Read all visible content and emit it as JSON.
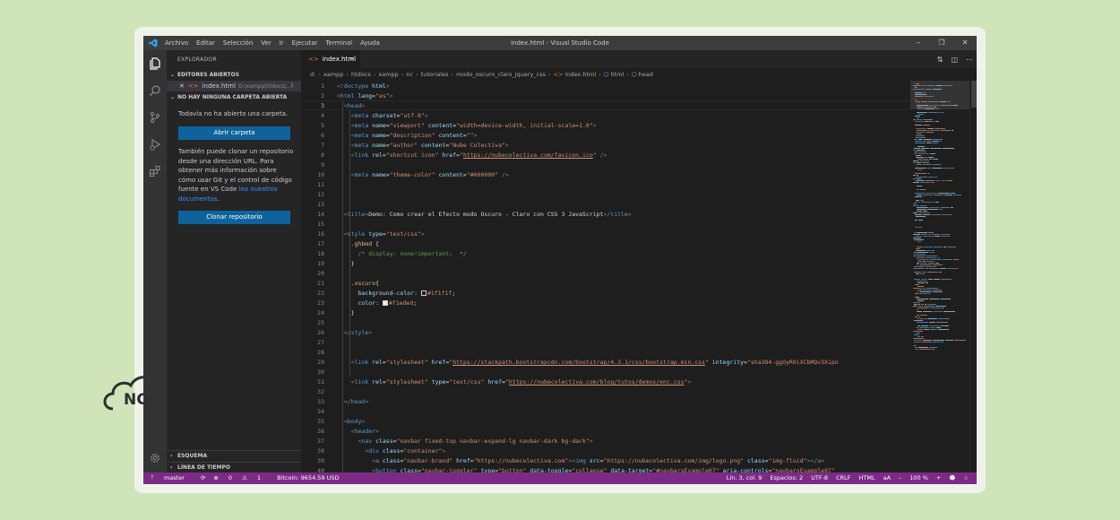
{
  "window": {
    "title": "index.html - Visual Studio Code",
    "menus": [
      "Archivo",
      "Editar",
      "Selección",
      "Ver",
      "Ir",
      "Ejecutar",
      "Terminal",
      "Ayuda"
    ]
  },
  "activity": {
    "icons": [
      "files-icon",
      "search-icon",
      "source-control-icon",
      "run-debug-icon",
      "extensions-icon",
      "gear-icon"
    ]
  },
  "sidebar": {
    "title": "EXPLORADOR",
    "open_editors_label": "EDITORES ABIERTOS",
    "open_file": {
      "name": "index.html",
      "path": "D:\\xampp\\htdocs\\...",
      "badge": "1"
    },
    "no_folder_label": "NO HAY NINGUNA CARPETA ABIERTA",
    "no_folder_text": "Todavía no ha abierto una carpeta.",
    "open_folder_button": "Abrir carpeta",
    "clone_text": "También puede clonar un repositorio desde una dirección URL. Para obtener más información sobre cómo usar Git y el control de código fuente en VS Code ",
    "clone_link": "lea nuestros documentos",
    "clone_text_end": ".",
    "clone_button": "Clonar repositorio",
    "outline_label": "ESQUEMA",
    "timeline_label": "LÍNEA DE TIEMPO"
  },
  "tab": {
    "label": "index.html",
    "close": "×"
  },
  "breadcrumb": [
    "d:",
    "xampp",
    "htdocs",
    "xampp",
    "nc",
    "tutoriales",
    "modo_oscuro_claro_jquery_css",
    "index.html",
    "html",
    "head"
  ],
  "editor": {
    "line_numbers": [
      "1",
      "2",
      "3",
      "4",
      "5",
      "6",
      "7",
      "8",
      "9",
      "10",
      "11",
      "12",
      "13",
      "14",
      "15",
      "16",
      "17",
      "18",
      "19",
      "20",
      "21",
      "22",
      "23",
      "24",
      "25",
      "26",
      "27",
      "28",
      "29",
      "30",
      "31",
      "32",
      "33",
      "34",
      "35",
      "36",
      "37",
      "38",
      "39",
      "40"
    ],
    "lines": [
      [
        [
          "t-punc",
          "<!"
        ],
        [
          "t-tag",
          "doctype"
        ],
        [
          "t-attr",
          " html"
        ],
        [
          "t-punc",
          ">"
        ]
      ],
      [
        [
          "t-punc",
          "<"
        ],
        [
          "t-tag",
          "html"
        ],
        [
          "t-attr",
          " lang"
        ],
        [
          "t-text",
          "="
        ],
        [
          "t-str",
          "\"es\""
        ],
        [
          "t-punc",
          ">"
        ]
      ],
      [
        [
          "t-text",
          "  "
        ],
        [
          "t-punc",
          "<"
        ],
        [
          "t-tag",
          "head"
        ],
        [
          "t-punc",
          ">"
        ]
      ],
      [
        [
          "t-text",
          "    "
        ],
        [
          "t-punc",
          "<"
        ],
        [
          "t-tag",
          "meta"
        ],
        [
          "t-attr",
          " charset"
        ],
        [
          "t-text",
          "="
        ],
        [
          "t-str",
          "\"utf-8\""
        ],
        [
          "t-punc",
          ">"
        ]
      ],
      [
        [
          "t-text",
          "    "
        ],
        [
          "t-punc",
          "<"
        ],
        [
          "t-tag",
          "meta"
        ],
        [
          "t-attr",
          " name"
        ],
        [
          "t-text",
          "="
        ],
        [
          "t-str",
          "\"viewport\""
        ],
        [
          "t-attr",
          " content"
        ],
        [
          "t-text",
          "="
        ],
        [
          "t-str",
          "\"width=device-width, initial-scale=1.0\""
        ],
        [
          "t-punc",
          ">"
        ]
      ],
      [
        [
          "t-text",
          "    "
        ],
        [
          "t-punc",
          "<"
        ],
        [
          "t-tag",
          "meta"
        ],
        [
          "t-attr",
          " name"
        ],
        [
          "t-text",
          "="
        ],
        [
          "t-str",
          "\"description\""
        ],
        [
          "t-attr",
          " content"
        ],
        [
          "t-text",
          "="
        ],
        [
          "t-str",
          "\"\""
        ],
        [
          "t-punc",
          ">"
        ]
      ],
      [
        [
          "t-text",
          "    "
        ],
        [
          "t-punc",
          "<"
        ],
        [
          "t-tag",
          "meta"
        ],
        [
          "t-attr",
          " name"
        ],
        [
          "t-text",
          "="
        ],
        [
          "t-str",
          "\"author\""
        ],
        [
          "t-attr",
          " content"
        ],
        [
          "t-text",
          "="
        ],
        [
          "t-str",
          "\"Nube Colectiva\""
        ],
        [
          "t-punc",
          ">"
        ]
      ],
      [
        [
          "t-text",
          "    "
        ],
        [
          "t-punc",
          "<"
        ],
        [
          "t-tag",
          "link"
        ],
        [
          "t-attr",
          " rel"
        ],
        [
          "t-text",
          "="
        ],
        [
          "t-str",
          "\"shortcut icon\""
        ],
        [
          "t-attr",
          " href"
        ],
        [
          "t-text",
          "="
        ],
        [
          "t-str",
          "\""
        ],
        [
          "t-link",
          "https://nubecolectiva.com/favicon.ico"
        ],
        [
          "t-str",
          "\""
        ],
        [
          "t-punc",
          " />"
        ]
      ],
      [],
      [
        [
          "t-text",
          "    "
        ],
        [
          "t-punc",
          "<"
        ],
        [
          "t-tag",
          "meta"
        ],
        [
          "t-attr",
          " name"
        ],
        [
          "t-text",
          "="
        ],
        [
          "t-str",
          "\"theme-color\""
        ],
        [
          "t-attr",
          " content"
        ],
        [
          "t-text",
          "="
        ],
        [
          "t-str",
          "\"#000000\""
        ],
        [
          "t-punc",
          " />"
        ]
      ],
      [],
      [],
      [],
      [
        [
          "t-text",
          "  "
        ],
        [
          "t-punc",
          "<"
        ],
        [
          "t-tag",
          "title"
        ],
        [
          "t-punc",
          ">"
        ],
        [
          "t-text",
          "Demo: Como crear el Efecto modo Oscuro - Claro con CSS 3 JavaScript"
        ],
        [
          "t-punc",
          "</"
        ],
        [
          "t-tag",
          "title"
        ],
        [
          "t-punc",
          ">"
        ]
      ],
      [],
      [
        [
          "t-text",
          "  "
        ],
        [
          "t-punc",
          "<"
        ],
        [
          "t-tag",
          "style"
        ],
        [
          "t-attr",
          " type"
        ],
        [
          "t-text",
          "="
        ],
        [
          "t-str",
          "\"text/css\""
        ],
        [
          "t-punc",
          ">"
        ]
      ],
      [
        [
          "t-text",
          "    "
        ],
        [
          "t-sel",
          ".ghbmd"
        ],
        [
          "t-text",
          " {"
        ]
      ],
      [
        [
          "t-text",
          "      "
        ],
        [
          "t-com",
          "/* display: none!important;  */"
        ]
      ],
      [
        [
          "t-text",
          "    }"
        ]
      ],
      [],
      [
        [
          "t-text",
          "    "
        ],
        [
          "t-sel",
          ".oscuro"
        ],
        [
          "t-text",
          "{"
        ]
      ],
      [
        [
          "t-text",
          "      "
        ],
        [
          "t-prop",
          "background-color"
        ],
        [
          "t-text",
          ": "
        ],
        [
          "swatch",
          "#1f1f1f"
        ],
        [
          "t-val",
          "#1f1f1f"
        ],
        [
          "t-text",
          ";"
        ]
      ],
      [
        [
          "t-text",
          "      "
        ],
        [
          "t-prop",
          "color"
        ],
        [
          "t-text",
          ": "
        ],
        [
          "swatch",
          "#f1eded"
        ],
        [
          "t-val",
          "#f1eded"
        ],
        [
          "t-text",
          ";"
        ]
      ],
      [
        [
          "t-text",
          "    }"
        ]
      ],
      [],
      [
        [
          "t-text",
          "  "
        ],
        [
          "t-punc",
          "</"
        ],
        [
          "t-tag",
          "style"
        ],
        [
          "t-punc",
          ">"
        ]
      ],
      [],
      [],
      [
        [
          "t-text",
          "    "
        ],
        [
          "t-punc",
          "<"
        ],
        [
          "t-tag",
          "link"
        ],
        [
          "t-attr",
          " rel"
        ],
        [
          "t-text",
          "="
        ],
        [
          "t-str",
          "\"stylesheet\""
        ],
        [
          "t-attr",
          " href"
        ],
        [
          "t-text",
          "="
        ],
        [
          "t-str",
          "\""
        ],
        [
          "t-link",
          "https://stackpath.bootstrapcdn.com/bootstrap/4.3.1/css/bootstrap.min.css"
        ],
        [
          "t-str",
          "\""
        ],
        [
          "t-attr",
          " integrity"
        ],
        [
          "t-text",
          "="
        ],
        [
          "t-str",
          "\"sha384-ggOyR0iXCbMQv3Xipn"
        ]
      ],
      [],
      [
        [
          "t-text",
          "    "
        ],
        [
          "t-punc",
          "<"
        ],
        [
          "t-tag",
          "link"
        ],
        [
          "t-attr",
          " rel"
        ],
        [
          "t-text",
          "="
        ],
        [
          "t-str",
          "\"stylesheet\""
        ],
        [
          "t-attr",
          " type"
        ],
        [
          "t-text",
          "="
        ],
        [
          "t-str",
          "\"text/css\""
        ],
        [
          "t-attr",
          " href"
        ],
        [
          "t-text",
          "="
        ],
        [
          "t-str",
          "\""
        ],
        [
          "t-link",
          "https://nubecolectiva.com/blog/tutos/demos/enc.css"
        ],
        [
          "t-str",
          "\""
        ],
        [
          "t-punc",
          ">"
        ]
      ],
      [],
      [
        [
          "t-text",
          "  "
        ],
        [
          "t-punc",
          "</"
        ],
        [
          "t-tag",
          "head"
        ],
        [
          "t-punc",
          ">"
        ]
      ],
      [],
      [
        [
          "t-text",
          "  "
        ],
        [
          "t-punc",
          "<"
        ],
        [
          "t-tag",
          "body"
        ],
        [
          "t-punc",
          ">"
        ]
      ],
      [
        [
          "t-text",
          "    "
        ],
        [
          "t-punc",
          "<"
        ],
        [
          "t-tag",
          "header"
        ],
        [
          "t-punc",
          ">"
        ]
      ],
      [
        [
          "t-text",
          "      "
        ],
        [
          "t-punc",
          "<"
        ],
        [
          "t-tag",
          "nav"
        ],
        [
          "t-attr",
          " class"
        ],
        [
          "t-text",
          "="
        ],
        [
          "t-str",
          "\"navbar fixed-top navbar-expand-lg navbar-dark bg-dark\""
        ],
        [
          "t-punc",
          ">"
        ]
      ],
      [
        [
          "t-text",
          "        "
        ],
        [
          "t-punc",
          "<"
        ],
        [
          "t-tag",
          "div"
        ],
        [
          "t-attr",
          " class"
        ],
        [
          "t-text",
          "="
        ],
        [
          "t-str",
          "\"container\""
        ],
        [
          "t-punc",
          ">"
        ]
      ],
      [
        [
          "t-text",
          "          "
        ],
        [
          "t-punc",
          "<"
        ],
        [
          "t-tag",
          "a"
        ],
        [
          "t-attr",
          " class"
        ],
        [
          "t-text",
          "="
        ],
        [
          "t-str",
          "\"navbar-brand\""
        ],
        [
          "t-attr",
          " href"
        ],
        [
          "t-text",
          "="
        ],
        [
          "t-str",
          "\"https://nubecolectiva.com\""
        ],
        [
          "t-punc",
          "><"
        ],
        [
          "t-tag",
          "img"
        ],
        [
          "t-attr",
          " src"
        ],
        [
          "t-text",
          "="
        ],
        [
          "t-str",
          "\"https://nubecolectiva.com/img/logo.png\""
        ],
        [
          "t-attr",
          " class"
        ],
        [
          "t-text",
          "="
        ],
        [
          "t-str",
          "\"img-fluid\""
        ],
        [
          "t-punc",
          "></"
        ],
        [
          "t-tag",
          "a"
        ],
        [
          "t-punc",
          ">"
        ]
      ],
      [
        [
          "t-text",
          "          "
        ],
        [
          "t-punc",
          "<"
        ],
        [
          "t-tag",
          "button"
        ],
        [
          "t-attr",
          " class"
        ],
        [
          "t-text",
          "="
        ],
        [
          "t-str",
          "\"navbar-toggler\""
        ],
        [
          "t-attr",
          " type"
        ],
        [
          "t-text",
          "="
        ],
        [
          "t-str",
          "\"button\""
        ],
        [
          "t-attr",
          " data-toggle"
        ],
        [
          "t-text",
          "="
        ],
        [
          "t-str",
          "\"collapse\""
        ],
        [
          "t-attr",
          " data-target"
        ],
        [
          "t-text",
          "="
        ],
        [
          "t-str",
          "\"#navbarsExample07\""
        ],
        [
          "t-attr",
          " aria-controls"
        ],
        [
          "t-text",
          "="
        ],
        [
          "t-str",
          "\"navbarsExample07\""
        ]
      ]
    ]
  },
  "status": {
    "branch": "master",
    "errors": "0",
    "warnings": "1",
    "bitcoin": "Bitcoin: 9654.59 USD",
    "position": "Lín. 3, col. 9",
    "spaces": "Espacios: 2",
    "encoding": "UTF-8",
    "eol": "CRLF",
    "language": "HTML",
    "zoom": "100 %"
  },
  "colors": {
    "status_bar": "#7b2b86",
    "accent_button": "#0e639c",
    "background": "#cfe4b8"
  }
}
